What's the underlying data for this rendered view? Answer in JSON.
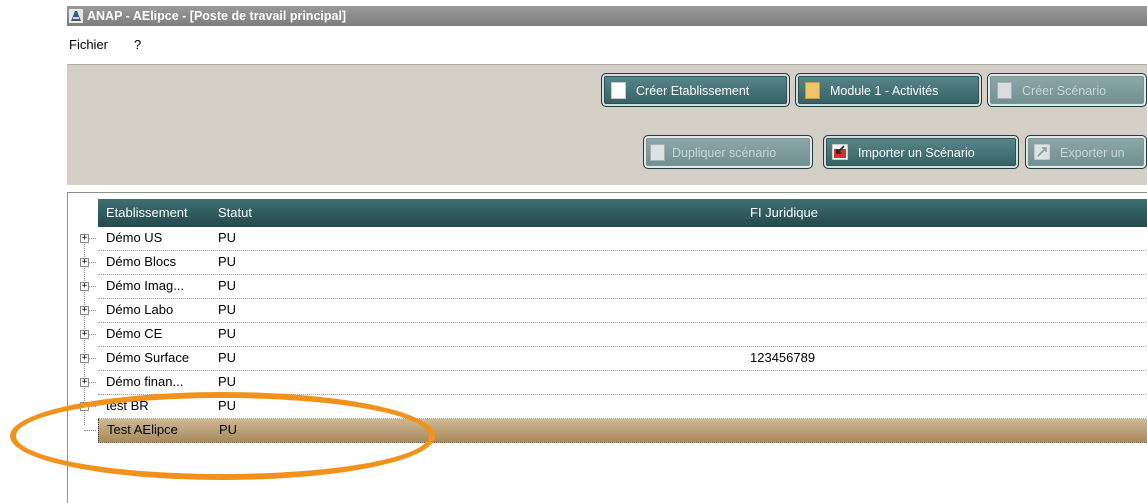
{
  "window": {
    "title": "ANAP - AElipce - [Poste de travail principal]"
  },
  "menu": {
    "items": [
      "Fichier",
      "?"
    ]
  },
  "toolbar": {
    "buttons": [
      {
        "label": "Créer Etablissement",
        "icon": "document-white-icon",
        "enabled": true
      },
      {
        "label": "Module 1 - Activités",
        "icon": "document-yellow-icon",
        "enabled": true
      },
      {
        "label": "Créer Scénario",
        "icon": "document-gray-icon",
        "enabled": false
      },
      {
        "label": "Dupliquer scénario",
        "icon": "duplicate-icon",
        "enabled": false
      },
      {
        "label": "Importer un Scénario",
        "icon": "import-icon",
        "enabled": true
      },
      {
        "label": "Exporter un",
        "icon": "export-icon",
        "enabled": false
      }
    ]
  },
  "tree": {
    "columns": [
      "Etablissement",
      "Statut",
      "FI Juridique"
    ],
    "rows": [
      {
        "etablissement": "Démo US",
        "statut": "PU",
        "fi": ""
      },
      {
        "etablissement": "Démo Blocs",
        "statut": "PU",
        "fi": ""
      },
      {
        "etablissement": "Démo Imag...",
        "statut": "PU",
        "fi": ""
      },
      {
        "etablissement": "Démo Labo",
        "statut": "PU",
        "fi": ""
      },
      {
        "etablissement": "Démo CE",
        "statut": "PU",
        "fi": ""
      },
      {
        "etablissement": "Démo Surface",
        "statut": "PU",
        "fi": "123456789"
      },
      {
        "etablissement": "Démo finan...",
        "statut": "PU",
        "fi": ""
      },
      {
        "etablissement": "test BR",
        "statut": "PU",
        "fi": ""
      },
      {
        "etablissement": "Test AElipce",
        "statut": "PU",
        "fi": "",
        "selected": true
      }
    ]
  },
  "colors": {
    "button_teal": "#305e61",
    "selected_row": "#b89d70",
    "highlight": "#f0921b"
  }
}
